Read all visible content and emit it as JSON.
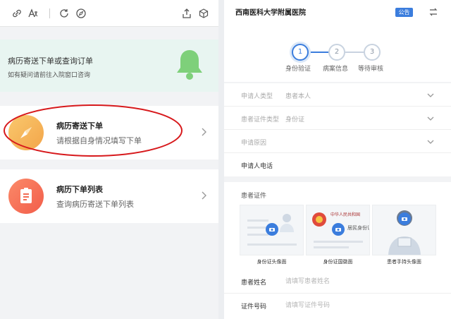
{
  "left_panel": {
    "toolbar": {
      "icons": [
        "link-icon",
        "translate-icon",
        "refresh-icon",
        "compass-icon",
        "share-icon",
        "cube-icon"
      ]
    },
    "banner": {
      "title": "病历寄送下单或查询订单",
      "subtitle": "如有疑问请前往入院窗口咨询",
      "icon": "bell-icon",
      "icon_color": "#7ed07a"
    },
    "cards": [
      {
        "title": "病历寄送下单",
        "subtitle": "请根据自身情况填写下单",
        "icon": "compass-icon"
      },
      {
        "title": "病历下单列表",
        "subtitle": "查询病历寄送下单列表",
        "icon": "document-icon"
      }
    ]
  },
  "right_panel": {
    "header": {
      "hospital_name": "西南医科大学附属医院",
      "notice_badge": "公告",
      "accent_color": "#3b7ddd"
    },
    "steps": [
      {
        "number": "1",
        "label": "身份验证",
        "active": true
      },
      {
        "number": "2",
        "label": "病案信息",
        "active": false
      },
      {
        "number": "3",
        "label": "等待审核",
        "active": false
      }
    ],
    "form": {
      "rows": [
        {
          "label": "申请人类型",
          "value": "患者本人"
        },
        {
          "label": "患者证件类型",
          "value": "身份证"
        },
        {
          "label": "申请原因",
          "value": ""
        },
        {
          "label": "申请人电话",
          "value": ""
        }
      ]
    },
    "documents": {
      "title": "患者证件",
      "items": [
        {
          "label": "身份证头像面"
        },
        {
          "label": "身份证国徽面",
          "inner_text_1": "中华人民共和国",
          "inner_text_2": "居民身份证"
        },
        {
          "label": "患者手持头像面"
        }
      ]
    },
    "inputs": [
      {
        "label": "患者姓名",
        "placeholder": "请填写患者姓名"
      },
      {
        "label": "证件号码",
        "placeholder": "请填写证件号码"
      }
    ]
  }
}
